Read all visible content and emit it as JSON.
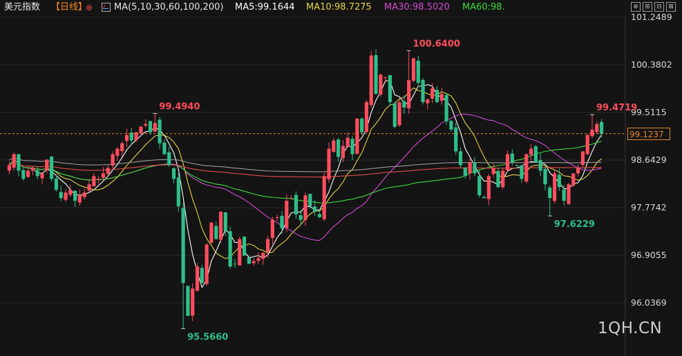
{
  "header": {
    "title": "美元指数",
    "period": "【日线】",
    "plus_symbol": "⊕",
    "ma_label": "MA(5,10,30,60,100,200)",
    "ma5": "MA5:99.1644",
    "ma10": "MA10:98.7275",
    "ma30": "MA30:98.5020",
    "ma60": "MA60:98."
  },
  "window_buttons": [
    "⊕",
    "⊞",
    "⊟",
    "⊠"
  ],
  "watermark": "1QH.CN",
  "current_price": "99.1237",
  "colors": {
    "up": "#ff4d5e",
    "down": "#2fbf8a",
    "ma5": "#ffffff",
    "ma10": "#e8d44a",
    "ma30": "#d24bd2",
    "ma60": "#3cdc3c",
    "ma100": "#e64a4a",
    "ma200": "#9a9a9a",
    "price_line": "#e68a2e",
    "high_label": "#ff4d5e",
    "low_label": "#2fbf8a"
  },
  "chart_data": {
    "type": "candlestick",
    "title": "美元指数",
    "y_ticks": [
      "101.2489",
      "100.3802",
      "99.5115",
      "98.6429",
      "97.7742",
      "96.9055",
      "96.0369"
    ],
    "ylim": [
      95.25,
      101.45
    ],
    "annotations": [
      {
        "text": "99.4940",
        "index": 31,
        "value": 99.494,
        "kind": "high"
      },
      {
        "text": "95.5660",
        "index": 37,
        "value": 95.566,
        "kind": "low"
      },
      {
        "text": "100.6400",
        "index": 85,
        "value": 100.64,
        "kind": "high"
      },
      {
        "text": "99.4719",
        "index": 124,
        "value": 99.4719,
        "kind": "high"
      },
      {
        "text": "97.6229",
        "index": 115,
        "value": 97.6229,
        "kind": "low"
      }
    ],
    "current_value": 99.1237,
    "closes": [
      98.55,
      98.75,
      98.45,
      98.3,
      98.45,
      98.5,
      98.35,
      98.4,
      98.65,
      98.3,
      98.1,
      97.95,
      98.05,
      98.1,
      97.9,
      98.0,
      98.05,
      98.2,
      98.35,
      98.3,
      98.4,
      98.5,
      98.75,
      98.85,
      98.95,
      99.1,
      99.0,
      99.15,
      99.25,
      99.3,
      99.15,
      99.32,
      98.95,
      98.75,
      98.55,
      98.3,
      97.8,
      96.4,
      95.8,
      96.3,
      96.7,
      96.4,
      97.1,
      97.5,
      97.2,
      97.7,
      97.35,
      96.7,
      96.75,
      97.2,
      96.9,
      96.75,
      96.8,
      96.85,
      96.95,
      97.2,
      97.55,
      97.6,
      97.4,
      97.9,
      97.95,
      97.65,
      97.55,
      98.0,
      97.8,
      97.7,
      97.6,
      98.35,
      98.85,
      99.0,
      98.7,
      98.9,
      99.05,
      98.75,
      99.4,
      99.15,
      99.7,
      100.55,
      99.85,
      100.2,
      100.15,
      99.7,
      99.25,
      99.7,
      99.6,
      100.1,
      100.5,
      100.05,
      99.7,
      99.75,
      99.95,
      99.7,
      99.85,
      99.35,
      99.2,
      98.8,
      98.55,
      98.35,
      98.6,
      98.4,
      98.0,
      97.95,
      98.35,
      98.5,
      98.15,
      98.45,
      98.75,
      98.6,
      98.55,
      98.3,
      98.75,
      98.85,
      98.6,
      98.45,
      98.2,
      97.95,
      98.4,
      98.15,
      97.9,
      98.2,
      98.4,
      98.5,
      98.8,
      99.1,
      99.2,
      99.3,
      99.12
    ],
    "ma_series": [
      {
        "name": "MA5",
        "color": "#ffffff"
      },
      {
        "name": "MA10",
        "color": "#e8d44a"
      },
      {
        "name": "MA30",
        "color": "#d24bd2"
      },
      {
        "name": "MA60",
        "color": "#3cdc3c"
      },
      {
        "name": "MA100",
        "color": "#e64a4a"
      },
      {
        "name": "MA200",
        "color": "#9a9a9a"
      }
    ]
  }
}
